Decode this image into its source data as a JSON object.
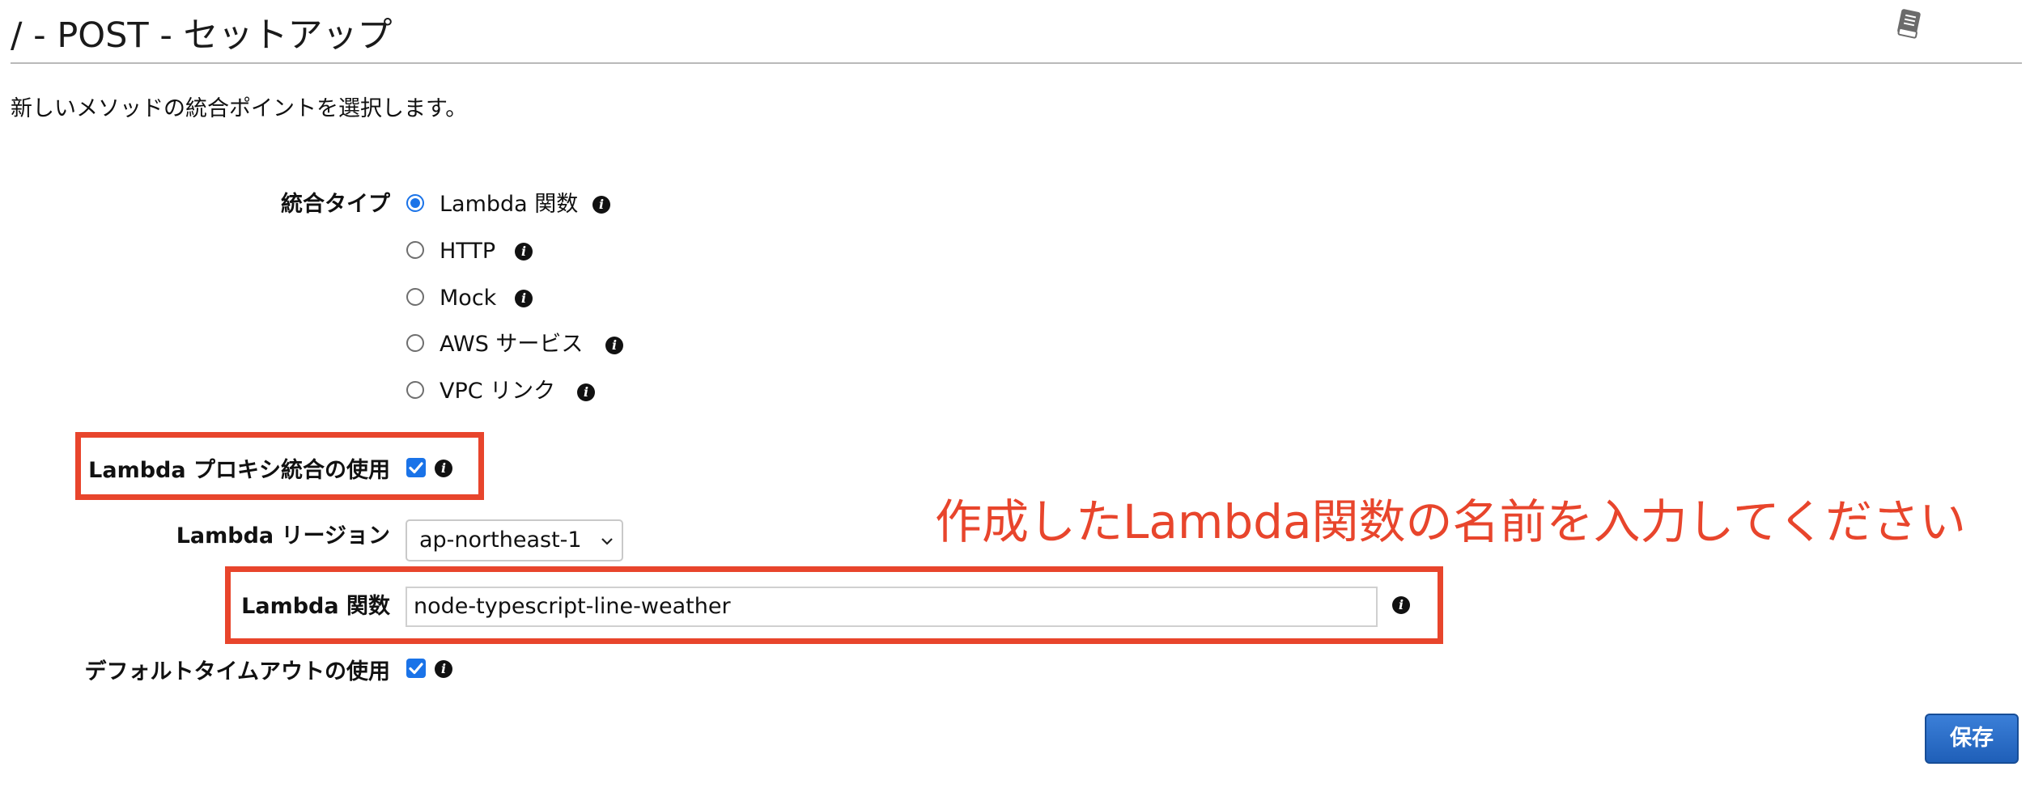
{
  "header": {
    "title": "/ - POST - セットアップ",
    "help_icon": "book-icon"
  },
  "subtitle": "新しいメソッドの統合ポイントを選択します。",
  "integration_type": {
    "label": "統合タイプ",
    "selected": "Lambda 関数",
    "options": [
      {
        "label": "Lambda 関数",
        "checked": true
      },
      {
        "label": "HTTP",
        "checked": false
      },
      {
        "label": "Mock",
        "checked": false
      },
      {
        "label": "AWS サービス",
        "checked": false
      },
      {
        "label": "VPC リンク",
        "checked": false
      }
    ]
  },
  "lambda_proxy": {
    "label": "Lambda プロキシ統合の使用",
    "checked": true
  },
  "lambda_region": {
    "label": "Lambda リージョン",
    "value": "ap-northeast-1"
  },
  "lambda_function": {
    "label": "Lambda 関数",
    "value": "node-typescript-line-weather"
  },
  "default_timeout": {
    "label": "デフォルトタイムアウトの使用",
    "checked": true
  },
  "annotation": "作成したLambda関数の名前を入力してください",
  "save_button": "保存",
  "colors": {
    "accent": "#1a73e8",
    "highlight": "#e8452c",
    "save_button": "#2a6bc9"
  }
}
